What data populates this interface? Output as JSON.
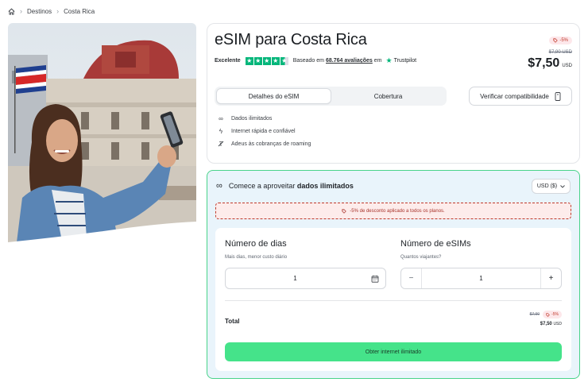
{
  "breadcrumb": {
    "items": [
      "Destinos",
      "Costa Rica"
    ]
  },
  "hero": {
    "alt": ""
  },
  "product": {
    "title": "eSIM para Costa Rica",
    "rating_label": "Excelente",
    "review_prefix": "Baseado em",
    "review_count": "68.764 avaliações",
    "review_suffix": "em",
    "trustpilot": "Trustpilot",
    "discount_badge": "-5%",
    "old_price": "$7,90 USD",
    "price": "$7,50",
    "currency": "USD",
    "tabs": [
      {
        "label": "Detalhes do eSIM",
        "active": true
      },
      {
        "label": "Cobertura",
        "active": false
      }
    ],
    "compat_button": "Verificar compatibilidade",
    "features": [
      {
        "icon": "infinity-icon",
        "text": "Dados ilimitados"
      },
      {
        "icon": "lightning-icon",
        "text": "Internet rápida e confiável"
      },
      {
        "icon": "no-roaming-icon",
        "text": "Adeus às cobranças de roaming"
      }
    ]
  },
  "order": {
    "heading_prefix": "Comece a aproveitar",
    "heading_bold": "dados ilimitados",
    "currency_select": "USD ($)",
    "promo": "-5% de desconto aplicado a todos os planos.",
    "days": {
      "label": "Número de dias",
      "hint": "Mais dias, menor custo diário",
      "value": "1"
    },
    "esims": {
      "label": "Número de eSIMs",
      "hint": "Quantos viajantes?",
      "value": "1",
      "minus": "−",
      "plus": "+"
    },
    "total_label": "Total",
    "total_old": "$7,90",
    "total_badge": "-5%",
    "total_price": "$7,50",
    "total_currency": "USD",
    "cta": "Obter internet ilimitado"
  },
  "colors": {
    "accent_green": "#45e38a",
    "border_green": "#49d38a",
    "discount_red": "#c0392b",
    "trustpilot_green": "#00b67a"
  }
}
